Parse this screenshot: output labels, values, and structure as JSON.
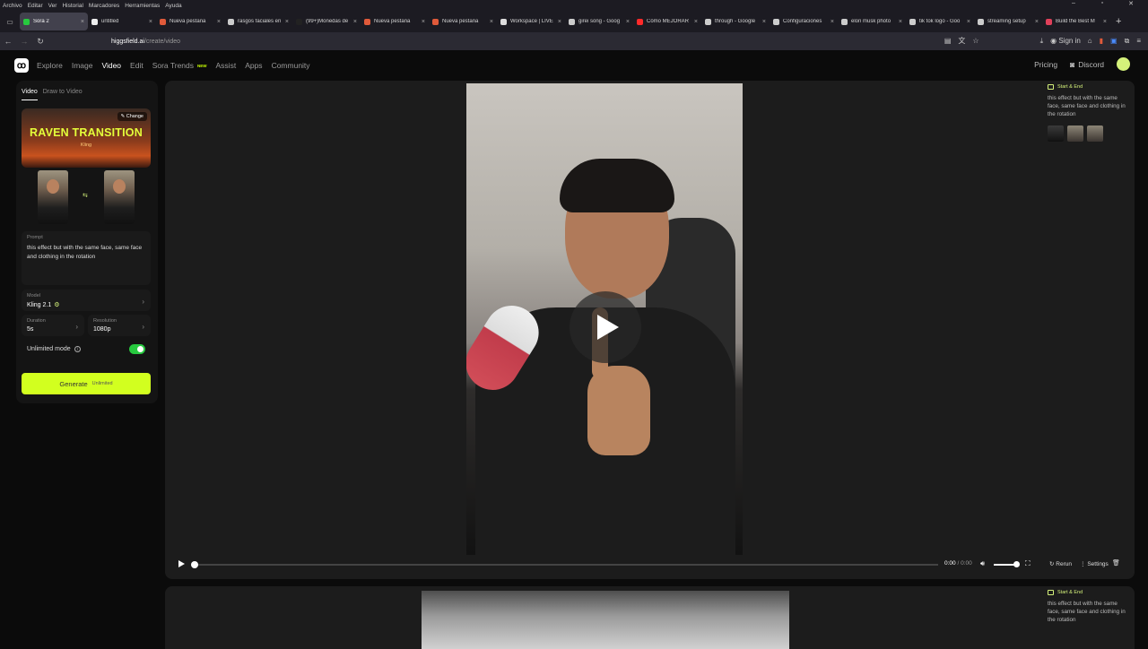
{
  "browser": {
    "menu": [
      "Archivo",
      "Editar",
      "Ver",
      "Historial",
      "Marcadores",
      "Herramientas",
      "Ayuda"
    ],
    "window_controls": [
      "–",
      "▫",
      "✕"
    ],
    "tabs": [
      {
        "title": "Sora 2",
        "active": true,
        "color": "#27c93f"
      },
      {
        "title": "untitled",
        "active": false,
        "color": "#eeeeee"
      },
      {
        "title": "Nueva pestaña",
        "active": false,
        "color": "#e05a3a"
      },
      {
        "title": "rasgos faciales en",
        "active": false,
        "color": "#cccccc"
      },
      {
        "title": "(99+)Monedas de",
        "active": false,
        "color": "#222222"
      },
      {
        "title": "Nueva pestaña",
        "active": false,
        "color": "#e05a3a"
      },
      {
        "title": "Nueva pestaña",
        "active": false,
        "color": "#e05a3a"
      },
      {
        "title": "Workspace | LIVE",
        "active": false,
        "color": "#dddddd"
      },
      {
        "title": "girei song - Goog",
        "active": false,
        "color": "#cccccc"
      },
      {
        "title": "Cómo MEJORAR",
        "active": false,
        "color": "#ff2a2a"
      },
      {
        "title": "through - Google",
        "active": false,
        "color": "#cccccc"
      },
      {
        "title": "Configuraciones",
        "active": false,
        "color": "#cccccc"
      },
      {
        "title": "elon musk photo",
        "active": false,
        "color": "#cccccc"
      },
      {
        "title": "tik tok logo - Goo",
        "active": false,
        "color": "#cccccc"
      },
      {
        "title": "streaming setup",
        "active": false,
        "color": "#cccccc"
      },
      {
        "title": "Build the Best M",
        "active": false,
        "color": "#e0405a"
      }
    ],
    "url_domain": "higgsfield.ai",
    "url_path": "/create/video",
    "sign_in": "Sign in"
  },
  "header": {
    "nav": [
      {
        "label": "Explore",
        "active": false
      },
      {
        "label": "Image",
        "active": false
      },
      {
        "label": "Video",
        "active": true
      },
      {
        "label": "Edit",
        "active": false
      },
      {
        "label": "Sora Trends",
        "active": false,
        "badge": "NEW"
      },
      {
        "label": "Assist",
        "active": false
      },
      {
        "label": "Apps",
        "active": false
      },
      {
        "label": "Community",
        "active": false
      }
    ],
    "pricing": "Pricing",
    "discord": "Discord"
  },
  "panel": {
    "tab_video": "Video",
    "tab_draw": "Draw to Video",
    "effect_title": "RAVEN TRANSITION",
    "effect_sub": "Kling",
    "change": "Change",
    "prompt_label": "Prompt",
    "prompt_text": "this effect but with the same face, same face and clothing in the rotation",
    "model_label": "Model",
    "model_value": "Kling 2.1",
    "duration_label": "Duration",
    "duration_value": "5s",
    "resolution_label": "Resolution",
    "resolution_value": "1080p",
    "unlimited_label": "Unlimited mode",
    "unlimited_on": true,
    "generate_label": "Generate",
    "generate_badge": "Unlimited"
  },
  "player": {
    "time_current": "0:00",
    "time_total": "/ 0:00",
    "rerun": "Rerun",
    "settings": "Settings"
  },
  "side": {
    "badge": "Start & End",
    "text": "this effect but with the same face, same face and clothing in the rotation"
  },
  "colors": {
    "accent": "#d2ff1f",
    "toggle": "#27c93f"
  }
}
